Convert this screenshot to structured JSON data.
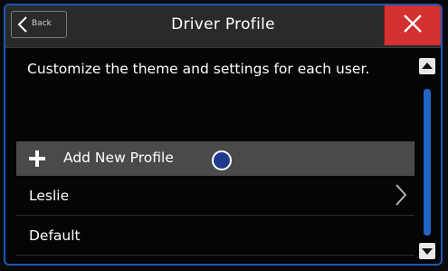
{
  "header": {
    "back_label": "Back",
    "title": "Driver Profile"
  },
  "main": {
    "description": "Customize the theme and settings for each user.",
    "items": [
      {
        "label": "Add New Profile",
        "icon": "plus-icon",
        "highlighted": true
      },
      {
        "label": "Leslie",
        "icon": "chevron-right-icon"
      },
      {
        "label": "Default"
      }
    ]
  },
  "colors": {
    "frame_border": "#1b57b5",
    "close_button": "#d33030",
    "highlight_row": "#4a4a4a",
    "scroll_thumb": "#1f64c7",
    "touch_indicator": "#1e3a8f"
  }
}
